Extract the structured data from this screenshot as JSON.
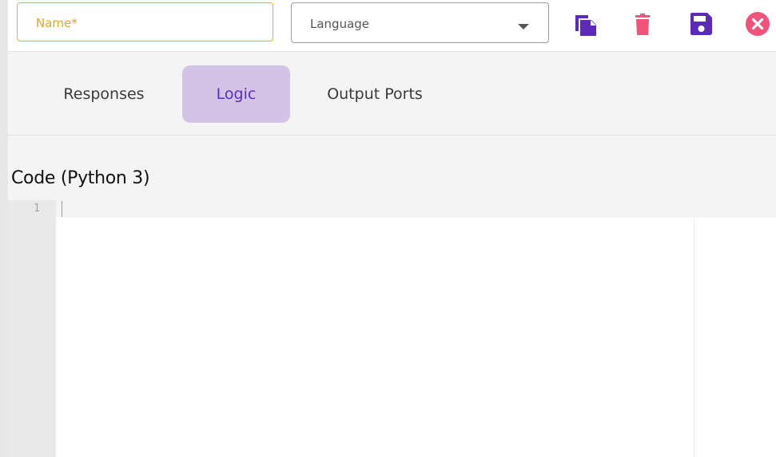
{
  "header": {
    "name_field": {
      "label": "Name",
      "required_marker": "*"
    },
    "language_select": {
      "value": "Language"
    },
    "actions": [
      {
        "name": "duplicate-button",
        "icon": "copy-icon",
        "color": "#5b2bb5"
      },
      {
        "name": "delete-button",
        "icon": "trash-icon",
        "color": "#f2537a"
      },
      {
        "name": "save-button",
        "icon": "save-icon",
        "color": "#5b2bb5"
      },
      {
        "name": "close-button",
        "icon": "close-circle-icon",
        "color": "#f2537a"
      }
    ]
  },
  "tabs": [
    {
      "label": "Responses",
      "active": false
    },
    {
      "label": "Logic",
      "active": true
    },
    {
      "label": "Output Ports",
      "active": false
    }
  ],
  "code": {
    "title": "Code (Python 3)",
    "line_numbers": [
      "1"
    ],
    "content": ""
  },
  "colors": {
    "accent": "#5a2ec4",
    "active_tab_bg": "#d3c3e6",
    "name_border": "#e6b422",
    "danger": "#f2537a"
  }
}
